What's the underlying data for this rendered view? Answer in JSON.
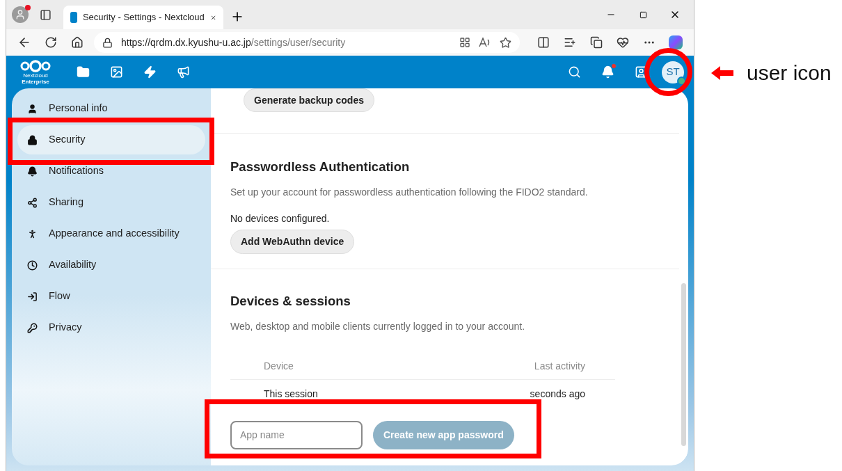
{
  "browser": {
    "tab_title": "Security - Settings - Nextcloud",
    "url_host": "https://qrdm.dx.kyushu-u.ac.jp",
    "url_path": "/settings/user/security"
  },
  "header": {
    "logo_name": "Nextcloud",
    "logo_edition": "Enterprise",
    "avatar_initials": "ST"
  },
  "sidebar": {
    "items": [
      {
        "label": "Personal info",
        "selected": false
      },
      {
        "label": "Security",
        "selected": true
      },
      {
        "label": "Notifications",
        "selected": false
      },
      {
        "label": "Sharing",
        "selected": false
      },
      {
        "label": "Appearance and accessibility",
        "selected": false
      },
      {
        "label": "Availability",
        "selected": false
      },
      {
        "label": "Flow",
        "selected": false
      },
      {
        "label": "Privacy",
        "selected": false
      }
    ]
  },
  "backup": {
    "button": "Generate backup codes"
  },
  "passwordless": {
    "title": "Passwordless Authentication",
    "description": "Set up your account for passwordless authentication following the FIDO2 standard.",
    "status": "No devices configured.",
    "button": "Add WebAuthn device"
  },
  "sessions": {
    "title": "Devices & sessions",
    "description": "Web, desktop and mobile clients currently logged in to your account.",
    "columns": [
      "Device",
      "Last activity"
    ],
    "rows": [
      {
        "device": "This session",
        "last_activity": "seconds ago"
      }
    ],
    "app_name": {
      "placeholder": "App name"
    },
    "create_button": {
      "label": "Create new app password",
      "disabled": true
    }
  },
  "annotation": {
    "label": "user icon"
  }
}
